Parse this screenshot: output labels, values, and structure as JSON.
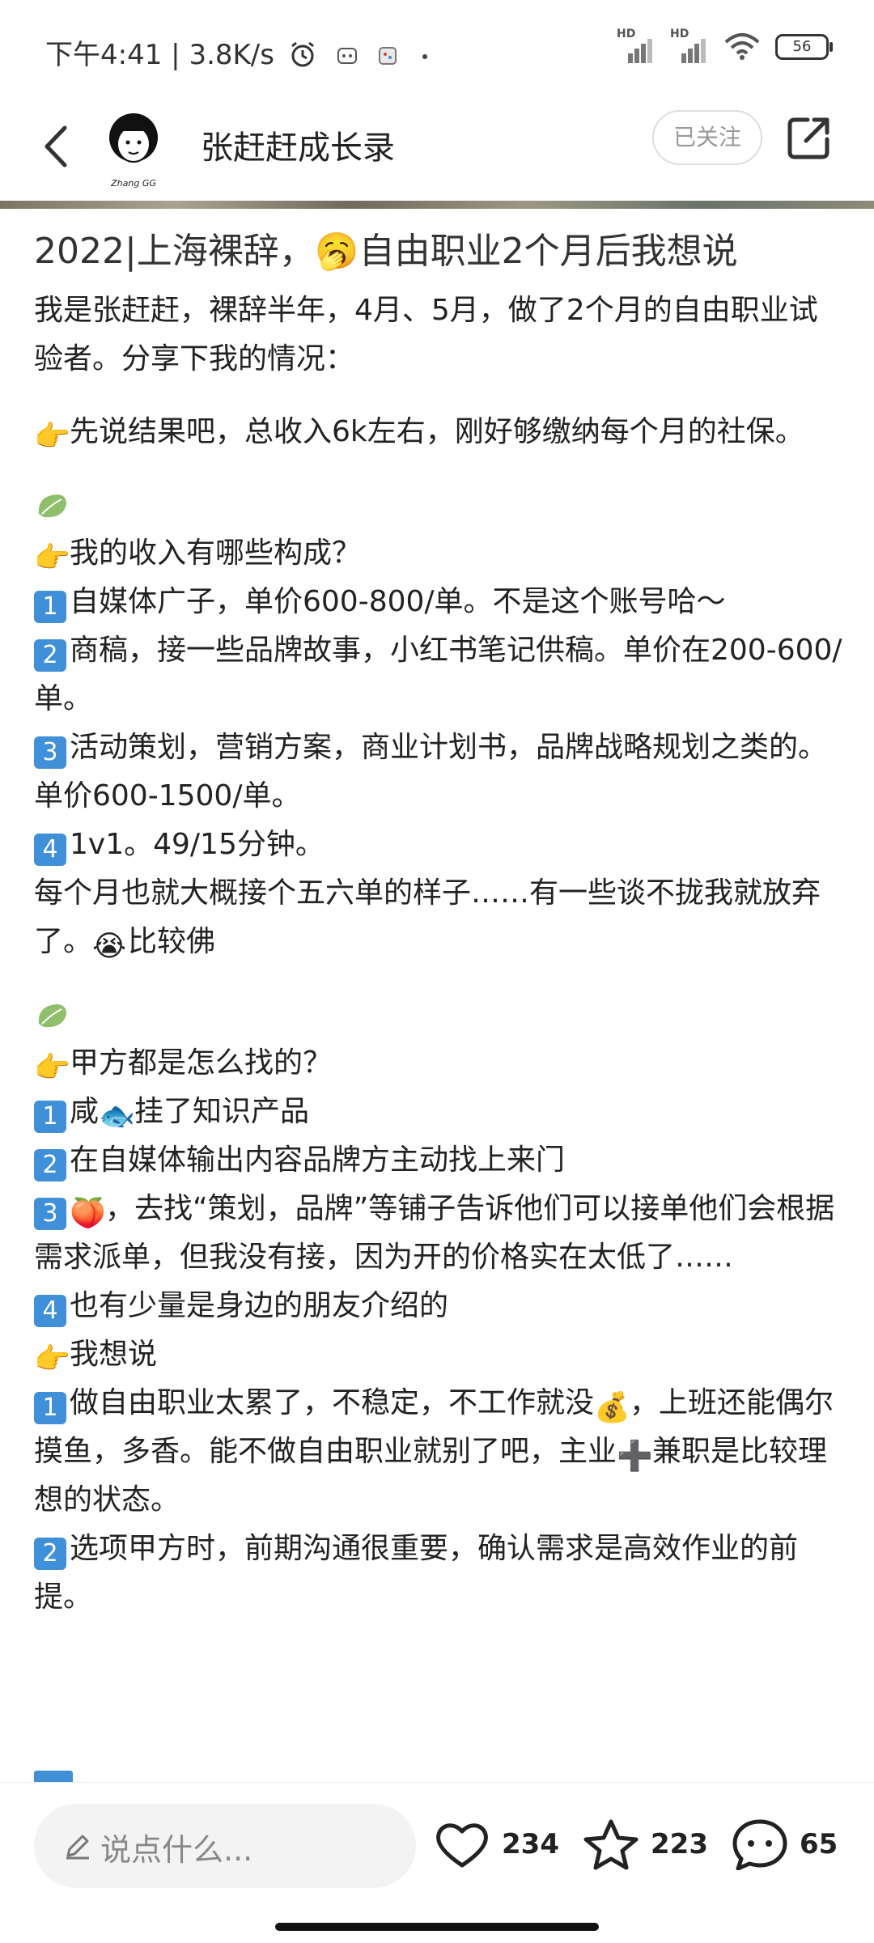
{
  "status_bar": {
    "time": "下午4:41",
    "speed": "3.8K/s",
    "battery": "56",
    "icons": [
      "alarm-icon",
      "app-notification-icon",
      "app-notification-icon",
      "dot-icon",
      "hd-signal-icon",
      "hd-signal-icon",
      "wifi-icon",
      "battery-icon"
    ]
  },
  "header": {
    "author_name": "张赶赶成长录",
    "avatar_caption": "Zhang GG",
    "follow_label": "已关注",
    "icons": [
      "back-icon",
      "share-icon"
    ]
  },
  "post": {
    "title": "2022|上海裸辞，🥱自由职业2个月后我想说",
    "intro": "我是张赶赶，裸辞半年，4月、5月，做了2个月的自由职业试验者。分享下我的情况：",
    "result": "先说结果吧，总收入6k左右，刚好够缴纳每个月的社保。",
    "income_heading": "我的收入有哪些构成？",
    "income_items": [
      {
        "key": "1",
        "text": "自媒体广子，单价600-800/单。不是这个账号哈～"
      },
      {
        "key": "2",
        "text": "商稿，接一些品牌故事，小红书笔记供稿。单价在200-600/单。"
      },
      {
        "key": "3",
        "text": "活动策划，营销方案，商业计划书，品牌战略规划之类的。单价600-1500/单。"
      },
      {
        "key": "4",
        "text": "1v1。49/15分钟。"
      }
    ],
    "income_footer_a": "每个月也就大概接个五六单的样子……有一些谈不拢我就放弃了。",
    "income_footer_b": "比较佛",
    "clients_heading": "甲方都是怎么找的？",
    "clients_items": [
      {
        "key": "1",
        "text_a": "咸",
        "text_b": "挂了知识产品"
      },
      {
        "key": "2",
        "text": "在自媒体输出内容品牌方主动找上来门"
      },
      {
        "key": "3",
        "text": "，去找“策划，品牌”等铺子告诉他们可以接单他们会根据需求派单，但我没有接，因为开的价格实在太低了……"
      },
      {
        "key": "4",
        "text": "也有少量是身边的朋友介绍的"
      }
    ],
    "thoughts_heading": "我想说",
    "thoughts_1a": "做自由职业太累了，不稳定，不工作就没",
    "thoughts_1b": "，上班还能偶尔摸鱼，多香。能不做自由职业就别了吧，主业",
    "thoughts_1c": "兼职是比较理想的状态。",
    "thoughts_2": "选项甲方时，前期沟通很重要，确认需求是高效作业的前提。"
  },
  "bottom_bar": {
    "comment_placeholder": "说点什么...",
    "likes": "234",
    "favorites": "223",
    "comments": "65"
  },
  "colors": {
    "keycap": "#3f8fd9",
    "accent": "#333333"
  }
}
